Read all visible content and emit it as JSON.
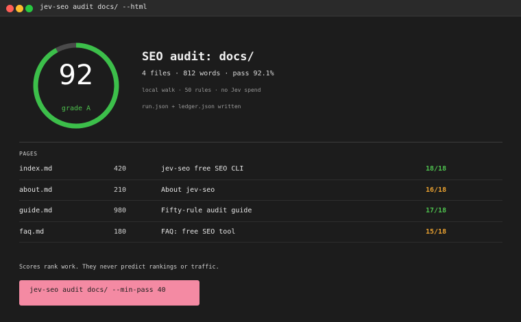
{
  "window": {
    "title": "jev-seo audit docs/ --html"
  },
  "colors": {
    "good": "#4ec04e",
    "warn": "#e8a030",
    "ring": "#3cbf4a",
    "ring_track": "#4a4a4a",
    "command_bg": "#f48aa3"
  },
  "score": {
    "value": "92",
    "grade": "grade A",
    "fraction": 0.92
  },
  "header": {
    "title": "SEO audit: docs/",
    "summary": "4 files · 812 words · pass 92.1%",
    "meta_walk": "local walk · 50 rules · no Jev spend",
    "meta_written": "run.json + ledger.json written"
  },
  "pages": {
    "label": "PAGES",
    "rows": [
      {
        "file": "index.md",
        "words": "420",
        "title": "jev-seo free SEO CLI",
        "pass": "18/18",
        "status": "good"
      },
      {
        "file": "about.md",
        "words": "210",
        "title": "About jev-seo",
        "pass": "16/18",
        "status": "warn"
      },
      {
        "file": "guide.md",
        "words": "980",
        "title": "Fifty-rule audit guide",
        "pass": "17/18",
        "status": "good"
      },
      {
        "file": "faq.md",
        "words": "180",
        "title": "FAQ: free SEO tool",
        "pass": "15/18",
        "status": "warn"
      }
    ]
  },
  "footer": {
    "disclaimer": "Scores rank work. They never predict rankings or traffic.",
    "command": "jev-seo audit docs/ --min-pass 40"
  }
}
